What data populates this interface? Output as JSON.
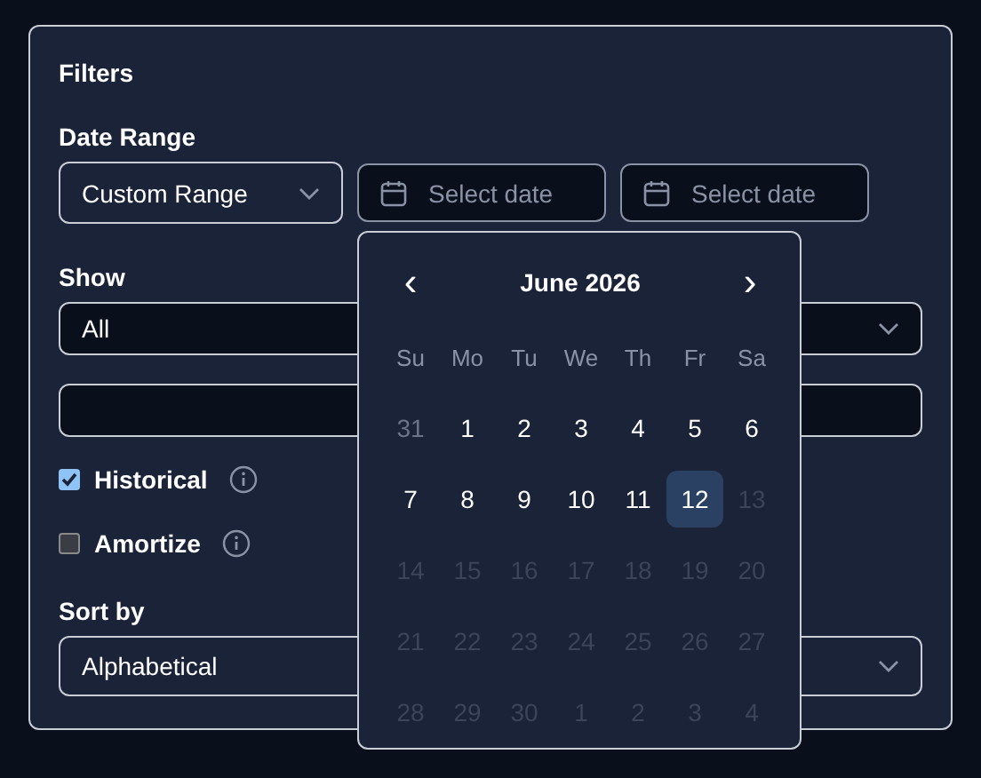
{
  "panel": {
    "title": "Filters"
  },
  "date_range": {
    "label": "Date Range",
    "select": {
      "value": "Custom Range"
    },
    "start": {
      "placeholder": "Select date"
    },
    "end": {
      "placeholder": "Select date"
    }
  },
  "show": {
    "label": "Show",
    "select": {
      "value": "All"
    }
  },
  "options": [
    {
      "label": "Historical",
      "checked": true
    },
    {
      "label": "Amortize",
      "checked": false
    }
  ],
  "sort": {
    "label": "Sort by",
    "select": {
      "value": "Alphabetical"
    }
  },
  "calendar": {
    "month": "June 2026",
    "prev": "‹",
    "next": "›",
    "weekdays": [
      "Su",
      "Mo",
      "Tu",
      "We",
      "Th",
      "Fr",
      "Sa"
    ],
    "days": [
      {
        "day": "31",
        "kind": "outside",
        "selected": false
      },
      {
        "day": "1",
        "kind": "enabled",
        "selected": false
      },
      {
        "day": "2",
        "kind": "enabled",
        "selected": false
      },
      {
        "day": "3",
        "kind": "enabled",
        "selected": false
      },
      {
        "day": "4",
        "kind": "enabled",
        "selected": false
      },
      {
        "day": "5",
        "kind": "enabled",
        "selected": false
      },
      {
        "day": "6",
        "kind": "enabled",
        "selected": false
      },
      {
        "day": "7",
        "kind": "enabled",
        "selected": false
      },
      {
        "day": "8",
        "kind": "enabled",
        "selected": false
      },
      {
        "day": "9",
        "kind": "enabled",
        "selected": false
      },
      {
        "day": "10",
        "kind": "enabled",
        "selected": false
      },
      {
        "day": "11",
        "kind": "enabled",
        "selected": false
      },
      {
        "day": "12",
        "kind": "enabled",
        "selected": true
      },
      {
        "day": "13",
        "kind": "disabled",
        "selected": false
      },
      {
        "day": "14",
        "kind": "disabled",
        "selected": false
      },
      {
        "day": "15",
        "kind": "disabled",
        "selected": false
      },
      {
        "day": "16",
        "kind": "disabled",
        "selected": false
      },
      {
        "day": "17",
        "kind": "disabled",
        "selected": false
      },
      {
        "day": "18",
        "kind": "disabled",
        "selected": false
      },
      {
        "day": "19",
        "kind": "disabled",
        "selected": false
      },
      {
        "day": "20",
        "kind": "disabled",
        "selected": false
      },
      {
        "day": "21",
        "kind": "disabled",
        "selected": false
      },
      {
        "day": "22",
        "kind": "disabled",
        "selected": false
      },
      {
        "day": "23",
        "kind": "disabled",
        "selected": false
      },
      {
        "day": "24",
        "kind": "disabled",
        "selected": false
      },
      {
        "day": "25",
        "kind": "disabled",
        "selected": false
      },
      {
        "day": "26",
        "kind": "disabled",
        "selected": false
      },
      {
        "day": "27",
        "kind": "disabled",
        "selected": false
      },
      {
        "day": "28",
        "kind": "disabled",
        "selected": false
      },
      {
        "day": "29",
        "kind": "disabled",
        "selected": false
      },
      {
        "day": "30",
        "kind": "disabled",
        "selected": false
      },
      {
        "day": "1",
        "kind": "disabled",
        "selected": false
      },
      {
        "day": "2",
        "kind": "disabled",
        "selected": false
      },
      {
        "day": "3",
        "kind": "disabled",
        "selected": false
      },
      {
        "day": "4",
        "kind": "disabled",
        "selected": false
      }
    ]
  }
}
